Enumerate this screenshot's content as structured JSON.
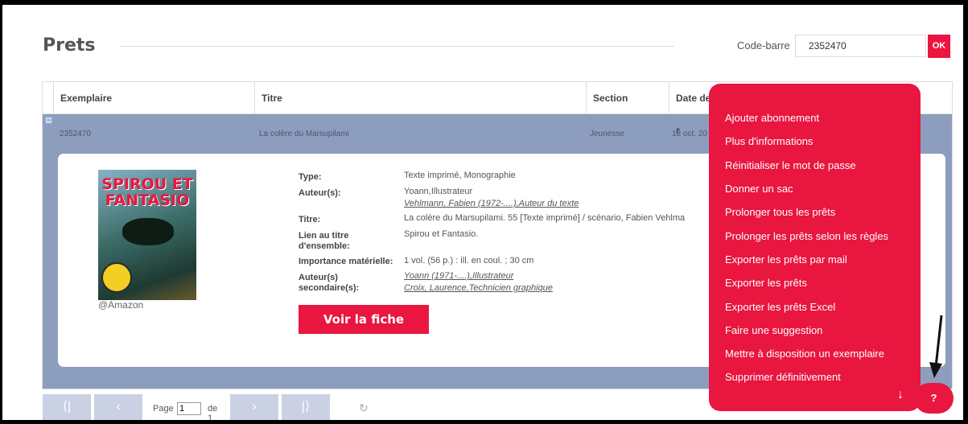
{
  "page": {
    "title": "Prets"
  },
  "barcode": {
    "label": "Code-barre",
    "value": "2352470",
    "ok_label": "OK"
  },
  "table": {
    "columns": [
      "Exemplaire",
      "Titre",
      "Section",
      "Date de r"
    ],
    "row": {
      "exemplaire": "2352470",
      "titre": "La colère du Marsupilami",
      "section": "Jeunesse",
      "date": "18 oct. 20"
    }
  },
  "detail": {
    "cover_text": "SPIROU ET FANTASIO",
    "image_credit": "@Amazon",
    "fields": [
      {
        "label": "Type:",
        "values": [
          "Texte imprimé, Monographie"
        ],
        "links": []
      },
      {
        "label": "Auteur(s):",
        "values": [
          "Yoann,Illustrateur"
        ],
        "links": [
          "Vehlmann, Fabien (1972-....),Auteur du texte"
        ]
      },
      {
        "label": "Titre:",
        "values": [
          "La colère du Marsupilami. 55 [Texte imprimé] / scénario, Fabien Vehlma"
        ],
        "links": []
      },
      {
        "label": "Lien au titre d'ensemble:",
        "values": [
          "Spirou et Fantasio."
        ],
        "links": []
      },
      {
        "label": "Importance matérielle:",
        "values": [
          "1 vol. (56 p.) : ill. en coul. ; 30 cm"
        ],
        "links": []
      },
      {
        "label": "Auteur(s) secondaire(s):",
        "values": [],
        "links": [
          "Yoann (1971-....),Illustrateur",
          "Croix, Laurence,Technicien graphique"
        ]
      }
    ],
    "voir_label": "Voir la fiche"
  },
  "pager": {
    "page_label": "Page",
    "page_value": "1",
    "of_label": "de 1"
  },
  "menu": {
    "items": [
      "Ajouter abonnement",
      "Plus d'informations",
      "Réinitialiser le mot de passe",
      "Donner un sac",
      "Prolonger tous les prêts",
      "Prolonger les prêts selon les règles",
      "Exporter les prêts par mail",
      "Exporter les prêts",
      "Exporter les prêts Excel",
      "Faire une suggestion",
      "Mettre à disposition un exemplaire",
      "Supprimer définitivement"
    ]
  },
  "help": {
    "label": "?"
  },
  "colors": {
    "accent": "#e9163f",
    "row_bg": "#8d9dbd",
    "pager_btn": "#c9d1e3"
  },
  "icons": [
    "first-page-icon",
    "prev-page-icon",
    "next-page-icon",
    "last-page-icon",
    "refresh-icon",
    "down-arrow-icon",
    "collapse-icon"
  ]
}
